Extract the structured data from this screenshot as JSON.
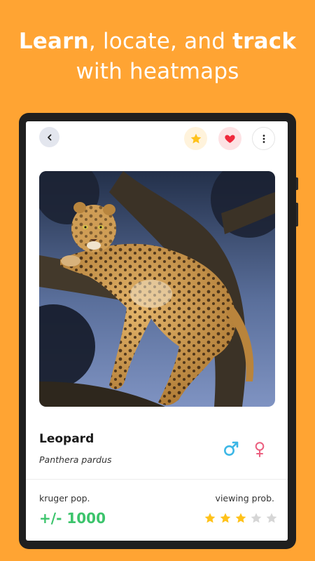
{
  "headline": {
    "line1_bold_a": "Learn",
    "line1_mid": ", locate, and ",
    "line1_bold_b": "track",
    "line2": "with heatmaps"
  },
  "toolbar": {
    "back_icon": "chevron-left-icon",
    "favorite_icon": "star-icon",
    "like_icon": "heart-icon",
    "more_icon": "more-vertical-icon"
  },
  "animal": {
    "name": "Leopard",
    "scientific_name": "Panthera pardus",
    "photo_subject": "leopard resting in a tree"
  },
  "sex_icons": [
    "male-icon",
    "female-icon"
  ],
  "stats": {
    "population_label": "kruger pop.",
    "population_value": "+/- 1000",
    "viewing_label": "viewing prob.",
    "viewing_rating": 3,
    "viewing_max": 5
  },
  "colors": {
    "background": "#FFA433",
    "star_active": "#FFC21A",
    "star_inactive": "#D6D6D6",
    "heart": "#F0283C",
    "male": "#3DB7E6",
    "female": "#EB5F7F",
    "population": "#3CC46C"
  }
}
